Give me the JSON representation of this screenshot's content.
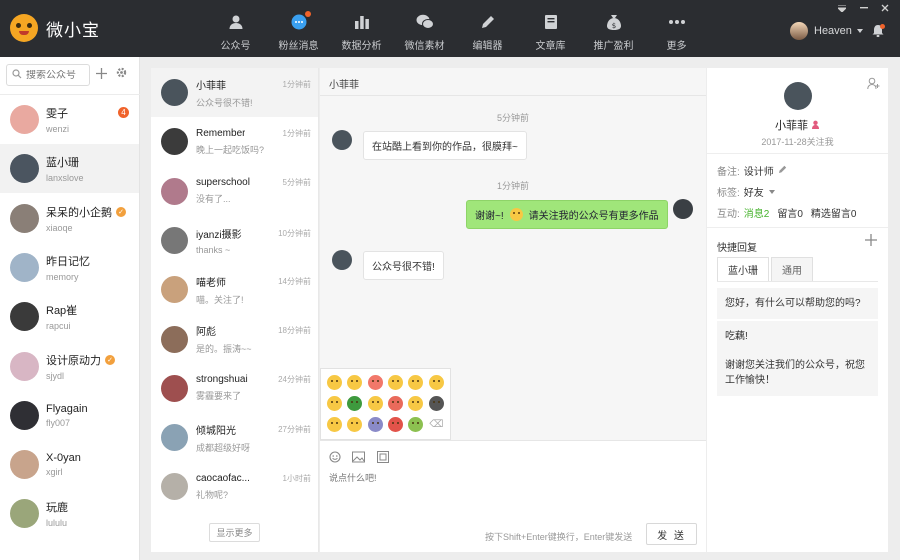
{
  "app": {
    "name": "微小宝"
  },
  "nav": [
    {
      "label": "公众号",
      "icon": "person-icon",
      "dot": false
    },
    {
      "label": "粉丝消息",
      "icon": "message-bubble-icon",
      "dot": true
    },
    {
      "label": "数据分析",
      "icon": "bar-chart-icon",
      "dot": false
    },
    {
      "label": "微信素材",
      "icon": "wechat-icon",
      "dot": false
    },
    {
      "label": "编辑器",
      "icon": "pencil-icon",
      "dot": false
    },
    {
      "label": "文章库",
      "icon": "book-icon",
      "dot": false
    },
    {
      "label": "推广盈利",
      "icon": "money-bag-icon",
      "dot": false
    },
    {
      "label": "更多",
      "icon": "more-dots-icon",
      "dot": false
    }
  ],
  "user": {
    "name": "Heaven"
  },
  "search": {
    "placeholder": "搜索公众号"
  },
  "accounts": [
    {
      "name": "雯子",
      "handle": "wenzi",
      "badge": "4",
      "verified": false,
      "color": "#e9a9a0"
    },
    {
      "name": "蓝小珊",
      "handle": "lanxslove",
      "badge": "",
      "verified": false,
      "color": "#4b5560",
      "active": true
    },
    {
      "name": "呆呆的小企鹅",
      "handle": "xiaoqe",
      "badge": "",
      "verified": true,
      "color": "#8a7f77"
    },
    {
      "name": "昨日记忆",
      "handle": "memory",
      "badge": "",
      "verified": false,
      "color": "#a0b4c8"
    },
    {
      "name": "Rap崔",
      "handle": "rapcui",
      "badge": "",
      "verified": false,
      "color": "#3a3a3a"
    },
    {
      "name": "设计原动力",
      "handle": "sjydl",
      "badge": "",
      "verified": true,
      "color": "#d8b6c4"
    },
    {
      "name": "Flyagain",
      "handle": "fly007",
      "badge": "",
      "verified": false,
      "color": "#2f2f34"
    },
    {
      "name": "X-0yan",
      "handle": "xgirl",
      "badge": "",
      "verified": false,
      "color": "#c8a48c"
    },
    {
      "name": "玩鹿",
      "handle": "lululu",
      "badge": "",
      "verified": false,
      "color": "#9aa67a"
    }
  ],
  "messages": [
    {
      "name": "小菲菲",
      "time": "1分钟前",
      "preview": "公众号很不错!",
      "color": "#4a545c",
      "active": true
    },
    {
      "name": "Remember",
      "time": "1分钟前",
      "preview": "晚上一起吃饭吗?",
      "color": "#3b3b3b"
    },
    {
      "name": "superschool",
      "time": "5分钟前",
      "preview": "没有了...",
      "color": "#b07a8c"
    },
    {
      "name": "iyanzi摄影",
      "time": "10分钟前",
      "preview": "thanks ~",
      "color": "#777"
    },
    {
      "name": "喵老师",
      "time": "14分钟前",
      "preview": "喵。关注了!",
      "color": "#c9a17c"
    },
    {
      "name": "阿彪",
      "time": "18分钟前",
      "preview": "是的。振涛~~",
      "color": "#8c6d5a"
    },
    {
      "name": "strongshuai",
      "time": "24分钟前",
      "preview": "雾霾要来了",
      "color": "#9e4f4f"
    },
    {
      "name": "倾城阳光",
      "time": "27分钟前",
      "preview": "成都超级好呀",
      "color": "#8aa2b4"
    },
    {
      "name": "caocaofac...",
      "time": "1小时前",
      "preview": "礼物呢?",
      "color": "#b5b0a8"
    }
  ],
  "show_more": "显示更多",
  "chat": {
    "title": "小菲菲",
    "ts1": "5分钟前",
    "msg1": "在站酷上看到你的作品，很膜拜~",
    "ts2": "1分钟前",
    "msg2_a": "谢谢~!",
    "msg2_b": "请关注我的公众号有更多作品",
    "msg3": "公众号很不错!",
    "input_placeholder": "说点什么吧!",
    "hint": "按下Shift+Enter键换行，Enter键发送",
    "send": "发 送"
  },
  "emojis": [
    "#f7c844",
    "#f7c844",
    "#f2786a",
    "#f7c844",
    "#f7c844",
    "#f7c844",
    "#f7c844",
    "#3e9a3e",
    "#f7c844",
    "#e96a5b",
    "#f7c844",
    "#555555",
    "#f7c844",
    "#f7c844",
    "#8a8ac8",
    "#e2534a",
    "#8cc050",
    "del"
  ],
  "profile": {
    "name": "小菲菲",
    "since": "2017-11-28关注我",
    "remark_label": "备注:",
    "remark_value": "设计师",
    "tag_label": "标签:",
    "tag_value": "好友",
    "interact_label": "互动:",
    "interact_msg": "消息2",
    "interact_comment": "留言0",
    "interact_featured": "精选留言0"
  },
  "quick_reply": {
    "title": "快捷回复",
    "tabs": [
      "蓝小珊",
      "通用"
    ],
    "items": [
      "您好，有什么可以帮助您的吗?",
      "吃藕!",
      "谢谢您关注我们的公众号，祝您工作愉快！"
    ]
  }
}
